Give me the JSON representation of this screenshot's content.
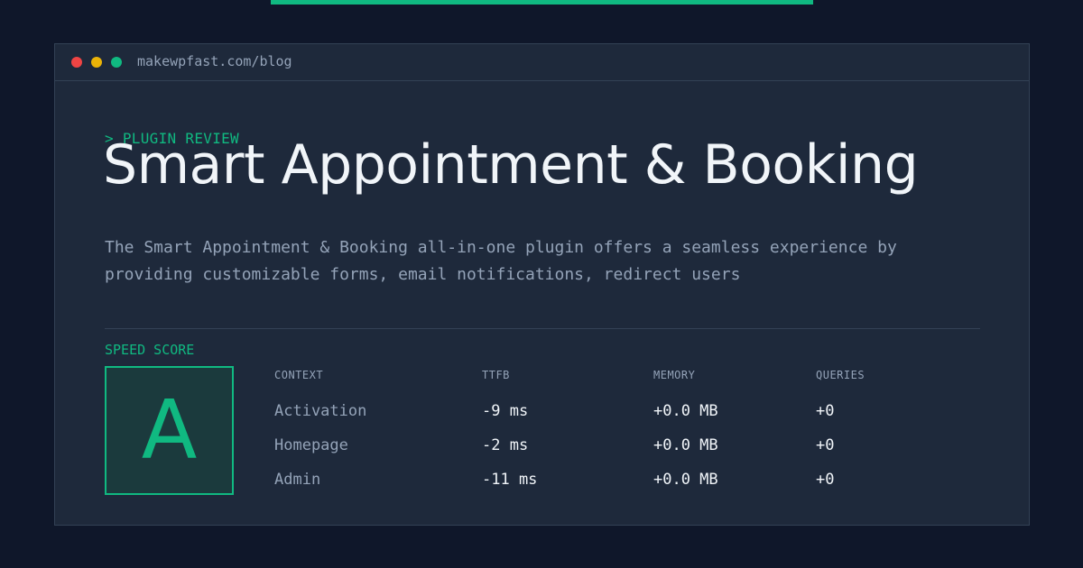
{
  "window": {
    "url": "makewpfast.com/blog"
  },
  "header": {
    "kicker": "> PLUGIN REVIEW",
    "title": "Smart Appointment & Booking",
    "description": "The Smart Appointment & Booking all-in-one plugin offers a seamless experience by providing customizable forms, email notifications, redirect users"
  },
  "score": {
    "label": "SPEED SCORE",
    "grade": "A"
  },
  "table": {
    "columns": [
      "CONTEXT",
      "TTFB",
      "MEMORY",
      "QUERIES"
    ],
    "rows": [
      {
        "context": "Activation",
        "ttfb": "-9 ms",
        "memory": "+0.0 MB",
        "queries": "+0"
      },
      {
        "context": "Homepage",
        "ttfb": "-2 ms",
        "memory": "+0.0 MB",
        "queries": "+0"
      },
      {
        "context": "Admin",
        "ttfb": "-11 ms",
        "memory": "+0.0 MB",
        "queries": "+0"
      }
    ]
  },
  "colors": {
    "accent": "#10b981",
    "background": "#0f172a",
    "panel": "#1e293b",
    "window_dot_close": "#ef4444",
    "window_dot_minimize": "#eab308",
    "window_dot_maximize": "#10b981"
  }
}
